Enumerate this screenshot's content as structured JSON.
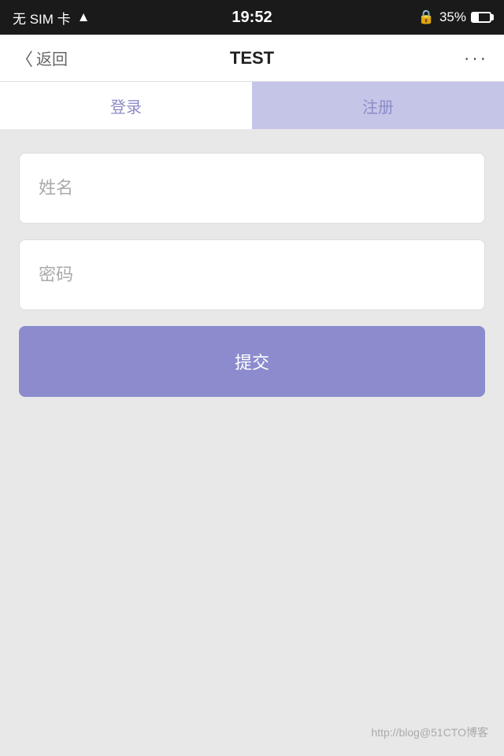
{
  "statusBar": {
    "carrier": "无 SIM 卡",
    "wifi": "WiFi",
    "time": "19:52",
    "lock": "🔒",
    "battery": "35%"
  },
  "navBar": {
    "backLabel": "返回",
    "title": "TEST",
    "moreLabel": "···"
  },
  "tabs": [
    {
      "id": "login",
      "label": "登录",
      "active": false
    },
    {
      "id": "register",
      "label": "注册",
      "active": true
    }
  ],
  "form": {
    "namePlaceholder": "姓名",
    "passwordPlaceholder": "密码",
    "submitLabel": "提交"
  },
  "watermark": "http://blog@51CTO博客"
}
